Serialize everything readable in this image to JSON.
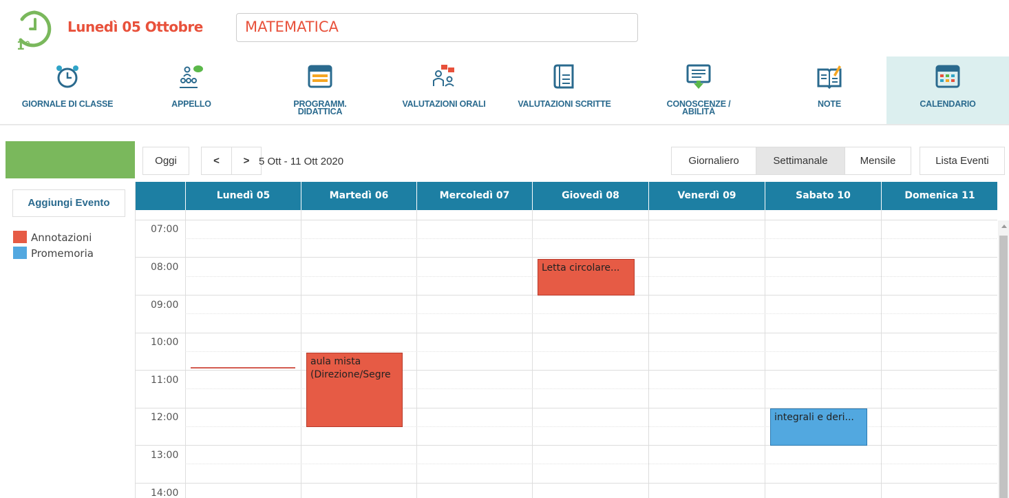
{
  "header": {
    "date_title": "Lunedì 05 Ottobre",
    "subject": "MATEMATICA",
    "logo_text": "1°"
  },
  "nav": {
    "items": [
      {
        "label": "GIORNALE DI CLASSE",
        "icon": "alarm-clock-icon"
      },
      {
        "label": "APPELLO",
        "icon": "attendance-icon"
      },
      {
        "label": "PROGRAMM.",
        "label2": "DIDATTICA",
        "icon": "planner-icon"
      },
      {
        "label": "VALUTAZIONI ORALI",
        "icon": "oral-grades-icon"
      },
      {
        "label": "VALUTAZIONI SCRITTE",
        "icon": "written-grades-icon"
      },
      {
        "label": "CONOSCENZE /",
        "label2": "ABILITÀ",
        "icon": "skills-board-icon"
      },
      {
        "label": "NOTE",
        "icon": "notes-book-icon"
      },
      {
        "label": "CALENDARIO",
        "icon": "calendar-icon",
        "active": true
      }
    ]
  },
  "sidebar": {
    "add_event": "Aggiungi Evento",
    "legend": [
      {
        "label": "Annotazioni",
        "color": "#e65b45"
      },
      {
        "label": "Promemoria",
        "color": "#52a8e0"
      }
    ]
  },
  "toolbar": {
    "today": "Oggi",
    "prev": "<",
    "next": ">",
    "range": "5 Ott - 11 Ott 2020",
    "views": [
      "Giornaliero",
      "Settimanale",
      "Mensile"
    ],
    "active_view": "Settimanale",
    "list": "Lista Eventi"
  },
  "calendar": {
    "days": [
      "Lunedì 05",
      "Martedì 06",
      "Mercoledì 07",
      "Giovedì 08",
      "Venerdì 09",
      "Sabato 10",
      "Domenica 11"
    ],
    "hours": [
      "07:00",
      "08:00",
      "09:00",
      "10:00",
      "11:00",
      "12:00",
      "13:00",
      "14:00"
    ],
    "header_color": "#1d7fa3",
    "events": [
      {
        "day": "Giovedì 08",
        "start": "08:00",
        "end": "09:00",
        "title": "Letta circolare...",
        "type": "Annotazioni"
      },
      {
        "day": "Martedì 06",
        "start": "10:30",
        "end": "12:30",
        "title": "aula mista",
        "title2": "(Direzione/Segre",
        "type": "Annotazioni"
      },
      {
        "day": "Sabato 10",
        "start": "12:00",
        "end": "13:00",
        "title": "integrali e deri...",
        "type": "Promemoria"
      }
    ]
  }
}
